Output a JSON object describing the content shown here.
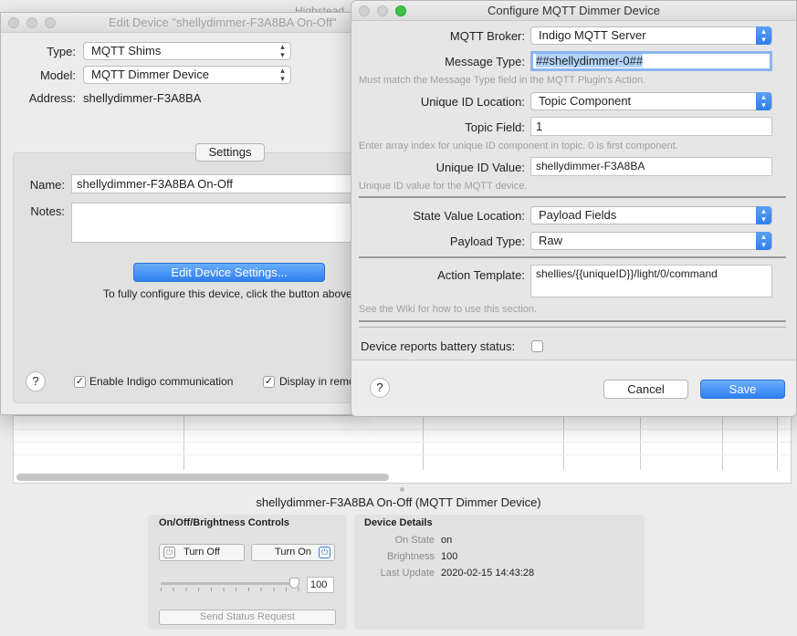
{
  "background": {
    "window_title_fragment": "Highstead",
    "device_title": "shellydimmer-F3A8BA On-Off (MQTT Dimmer Device)",
    "controls": {
      "title": "On/Off/Brightness Controls",
      "turn_off": "Turn Off",
      "turn_on": "Turn On",
      "brightness_value": "100",
      "brightness_level": 1.0,
      "send_status": "Send Status Request"
    },
    "details": {
      "title": "Device Details",
      "rows": [
        {
          "label": "On State",
          "value": "on"
        },
        {
          "label": "Brightness",
          "value": "100"
        },
        {
          "label": "Last Update",
          "value": "2020-02-15 14:43:28"
        }
      ]
    }
  },
  "edit_device": {
    "title": "Edit Device \"shellydimmer-F3A8BA On-Off\"",
    "type_label": "Type:",
    "type_value": "MQTT Shims",
    "model_label": "Model:",
    "model_value": "MQTT Dimmer Device",
    "address_label": "Address:",
    "address_value": "shellydimmer-F3A8BA",
    "settings_tab": "Settings",
    "name_label": "Name:",
    "name_value": "shellydimmer-F3A8BA On-Off",
    "notes_label": "Notes:",
    "notes_value": "",
    "edit_settings_button": "Edit Device Settings...",
    "configure_hint": "To fully configure this device, click the button above",
    "help": "?",
    "enable_comm": "Enable Indigo communication",
    "enable_comm_checked": true,
    "display_remote": "Display in remote",
    "display_remote_checked": true
  },
  "configure": {
    "title": "Configure MQTT Dimmer Device",
    "broker_label": "MQTT Broker:",
    "broker_value": "Indigo MQTT Server",
    "message_type_label": "Message Type:",
    "message_type_value": "##shellydimmer-0##",
    "message_type_hint": "Must match the Message Type field in the MQTT Plugin's Action.",
    "uid_location_label": "Unique ID Location:",
    "uid_location_value": "Topic Component",
    "topic_field_label": "Topic Field:",
    "topic_field_value": "1",
    "topic_field_hint": "Enter array index for unique ID component in topic.  0 is first component.",
    "uid_value_label": "Unique ID Value:",
    "uid_value_value": "shellydimmer-F3A8BA",
    "uid_value_hint": "Unique ID value for the MQTT device.",
    "state_location_label": "State Value Location:",
    "state_location_value": "Payload Fields",
    "payload_type_label": "Payload Type:",
    "payload_type_value": "Raw",
    "action_template_label": "Action Template:",
    "action_template_value": "shellies/{{uniqueID}}/light/0/command",
    "wiki_hint": "See the Wiki for how to use this section.",
    "battery_label": "Device reports battery status:",
    "battery_checked": false,
    "help": "?",
    "cancel": "Cancel",
    "save": "Save"
  }
}
